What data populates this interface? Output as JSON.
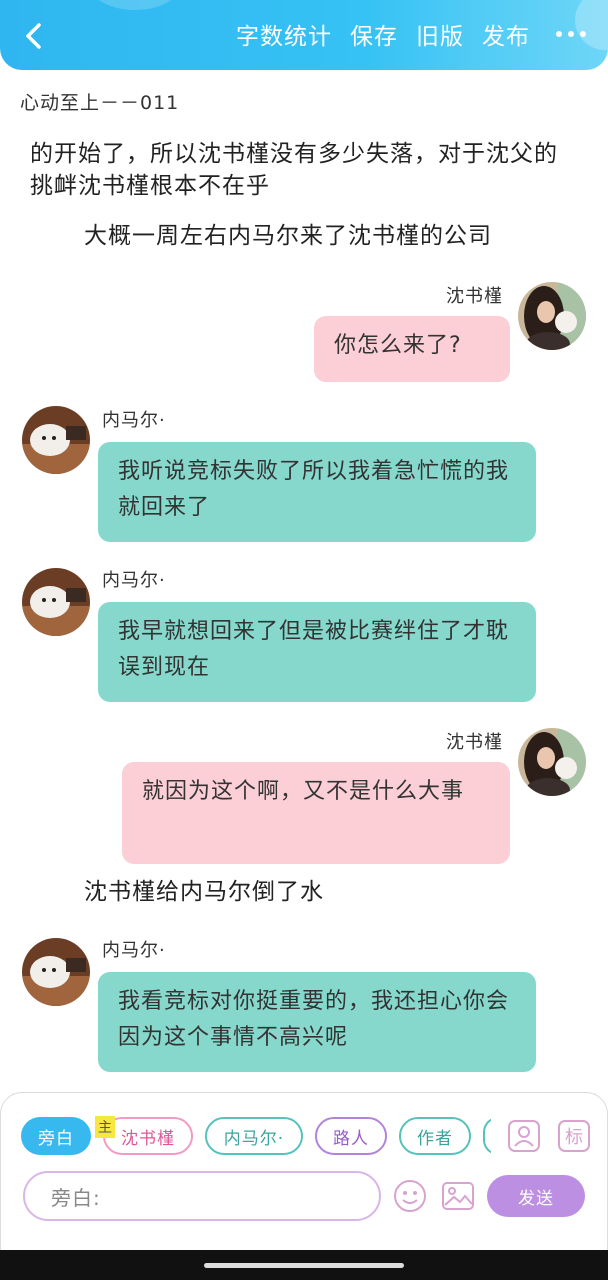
{
  "header": {
    "back_icon": "chevron-left-icon",
    "actions": [
      "字数统计",
      "保存",
      "旧版",
      "发布"
    ],
    "more_icon": "more-horizontal-icon"
  },
  "chapter_title": "心动至上－－011",
  "messages": [
    {
      "type": "narration",
      "text": "的开始了，所以沈书槿没有多少失落，对于沈父的挑衅沈书槿根本不在乎"
    },
    {
      "type": "narration",
      "text": "大概一周左右内马尔来了沈书槿的公司"
    },
    {
      "type": "dialog",
      "side": "right",
      "speaker": "沈书槿",
      "text": "你怎么来了?"
    },
    {
      "type": "dialog",
      "side": "left",
      "speaker": "内马尔·",
      "text": "我听说竞标失败了所以我着急忙慌的我就回来了"
    },
    {
      "type": "dialog",
      "side": "left",
      "speaker": "内马尔·",
      "text": "我早就想回来了但是被比赛绊住了才耽误到现在"
    },
    {
      "type": "dialog",
      "side": "right",
      "speaker": "沈书槿",
      "text": "就因为这个啊，又不是什么大事"
    },
    {
      "type": "narration",
      "text": "沈书槿给内马尔倒了水"
    },
    {
      "type": "dialog",
      "side": "left",
      "speaker": "内马尔·",
      "text": "我看竞标对你挺重要的，我还担心你会因为这个事情不高兴呢"
    }
  ],
  "composer": {
    "owner_badge": "主",
    "roles": [
      "旁白",
      "沈书槿",
      "内马尔·",
      "路人",
      "作者"
    ],
    "selected_role": "旁白",
    "input_placeholder": "旁白:",
    "send_label": "发送",
    "icons": [
      "person-card-icon",
      "mark-icon",
      "emoji-icon",
      "image-icon"
    ]
  },
  "colors": {
    "header": "#36c2f4",
    "pink_bubble": "#fccfd7",
    "teal_bubble": "#86d8cd",
    "send_button": "#bc8fe3",
    "narration_chip": "#37b8ef"
  }
}
